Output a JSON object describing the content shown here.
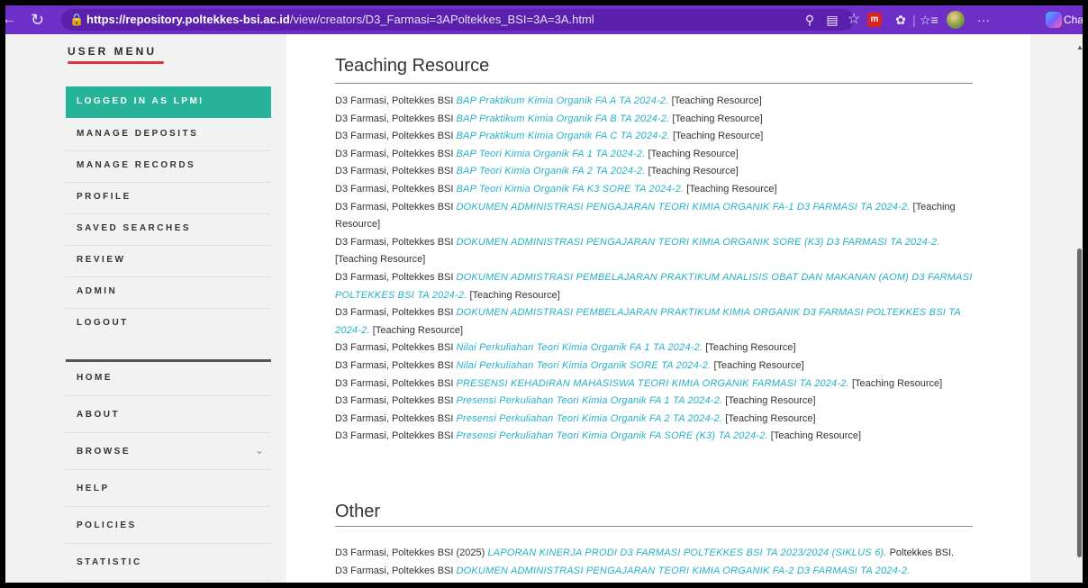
{
  "browser": {
    "url_domain": "https://repository.poltekkes-bsi.ac.id",
    "url_path": "/view/creators/D3_Farmasi=3APoltekkes_BSI=3A=3A.html",
    "chat_label": "Chat",
    "back_icon": "back-arrow-icon",
    "refresh_icon": "refresh-icon",
    "colors": {
      "bar": "#6d2fc6"
    }
  },
  "sidebar": {
    "title": "USER MENU",
    "user_items": [
      {
        "label": "LOGGED IN AS LPMI",
        "active": true
      },
      {
        "label": "MANAGE DEPOSITS"
      },
      {
        "label": "MANAGE RECORDS"
      },
      {
        "label": "PROFILE"
      },
      {
        "label": "SAVED SEARCHES"
      },
      {
        "label": "REVIEW"
      },
      {
        "label": "ADMIN"
      },
      {
        "label": "LOGOUT"
      }
    ],
    "nav_items": [
      {
        "label": "HOME"
      },
      {
        "label": "ABOUT"
      },
      {
        "label": "BROWSE"
      },
      {
        "label": "HELP"
      },
      {
        "label": "POLICIES"
      },
      {
        "label": "STATISTIC"
      }
    ],
    "accent_color": "#26b39a"
  },
  "content": {
    "section_teaching": "Teaching Resource",
    "section_other": "Other",
    "teaching": [
      {
        "author": "D3 Farmasi, Poltekkes BSI",
        "title": "BAP Praktikum Kimia Organik FA A TA 2024-2.",
        "type": "[Teaching Resource]"
      },
      {
        "author": "D3 Farmasi, Poltekkes BSI",
        "title": "BAP Praktikum Kimia Organik FA B TA 2024-2.",
        "type": "[Teaching Resource]"
      },
      {
        "author": "D3 Farmasi, Poltekkes BSI",
        "title": "BAP Praktikum Kimia Organik FA C TA 2024-2.",
        "type": "[Teaching Resource]"
      },
      {
        "author": "D3 Farmasi, Poltekkes BSI",
        "title": "BAP Teori Kimia Organik FA 1 TA 2024-2.",
        "type": "[Teaching Resource]"
      },
      {
        "author": "D3 Farmasi, Poltekkes BSI",
        "title": "BAP Teori Kimia Organik FA 2 TA 2024-2.",
        "type": "[Teaching Resource]"
      },
      {
        "author": "D3 Farmasi, Poltekkes BSI",
        "title": "BAP Teori Kimia Organik FA K3 SORE TA 2024-2.",
        "type": "[Teaching Resource]"
      },
      {
        "author": "D3 Farmasi, Poltekkes BSI",
        "title": "DOKUMEN ADMINISTRASI PENGAJARAN TEORI KIMIA ORGANIK FA-1 D3 FARMASI TA 2024-2.",
        "type": "[Teaching Resource]"
      },
      {
        "author": "D3 Farmasi, Poltekkes BSI",
        "title": "DOKUMEN ADMINISTRASI PENGAJARAN TEORI KIMIA ORGANIK SORE (K3) D3 FARMASI TA 2024-2.",
        "type": "[Teaching Resource]"
      },
      {
        "author": "D3 Farmasi, Poltekkes BSI",
        "title": "DOKUMEN ADMISTRASI PEMBELAJARAN PRAKTIKUM ANALISIS OBAT DAN MAKANAN (AOM) D3 FARMASI POLTEKKES BSI TA 2024-2.",
        "type": "[Teaching Resource]"
      },
      {
        "author": "D3 Farmasi, Poltekkes BSI",
        "title": "DOKUMEN ADMISTRASI PEMBELAJARAN PRAKTIKUM KIMIA ORGANIK D3 FARMASI POLTEKKES BSI TA 2024-2.",
        "type": "[Teaching Resource]"
      },
      {
        "author": "D3 Farmasi, Poltekkes BSI",
        "title": "Nilai Perkuliahan Teori Kimia Organik FA 1 TA 2024-2.",
        "type": "[Teaching Resource]"
      },
      {
        "author": "D3 Farmasi, Poltekkes BSI",
        "title": "Nilai Perkuliahan Teori Kimia Organik SORE TA 2024-2.",
        "type": "[Teaching Resource]"
      },
      {
        "author": "D3 Farmasi, Poltekkes BSI",
        "title": "PRESENSI KEHADIRAN MAHASISWA TEORI KIMIA ORGANIK FARMASI TA 2024-2.",
        "type": "[Teaching Resource]"
      },
      {
        "author": "D3 Farmasi, Poltekkes BSI",
        "title": "Presensi Perkuliahan Teori Kimia Organik FA 1 TA 2024-2.",
        "type": "[Teaching Resource]"
      },
      {
        "author": "D3 Farmasi, Poltekkes BSI",
        "title": "Presensi Perkuliahan Teori Kimia Organik FA 2 TA 2024-2.",
        "type": "[Teaching Resource]"
      },
      {
        "author": "D3 Farmasi, Poltekkes BSI",
        "title": "Presensi Perkuliahan Teori Kimia Organik FA SORE (K3) TA 2024-2.",
        "type": "[Teaching Resource]"
      }
    ],
    "other": [
      {
        "author": "D3 Farmasi, Poltekkes BSI",
        "year": "(2025)",
        "title": "LAPORAN KINERJA PRODI D3 FARMASI POLTEKKES BSI TA 2023/2024 (SIKLUS 6).",
        "publisher": "Poltekkes BSI."
      },
      {
        "author": "D3 Farmasi, Poltekkes BSI",
        "title": "DOKUMEN ADMINISTRASI PENGAJARAN TEORI KIMIA ORGANIK FA-2 D3 FARMASI TA 2024-2."
      }
    ],
    "link_color": "#25b1c8"
  }
}
